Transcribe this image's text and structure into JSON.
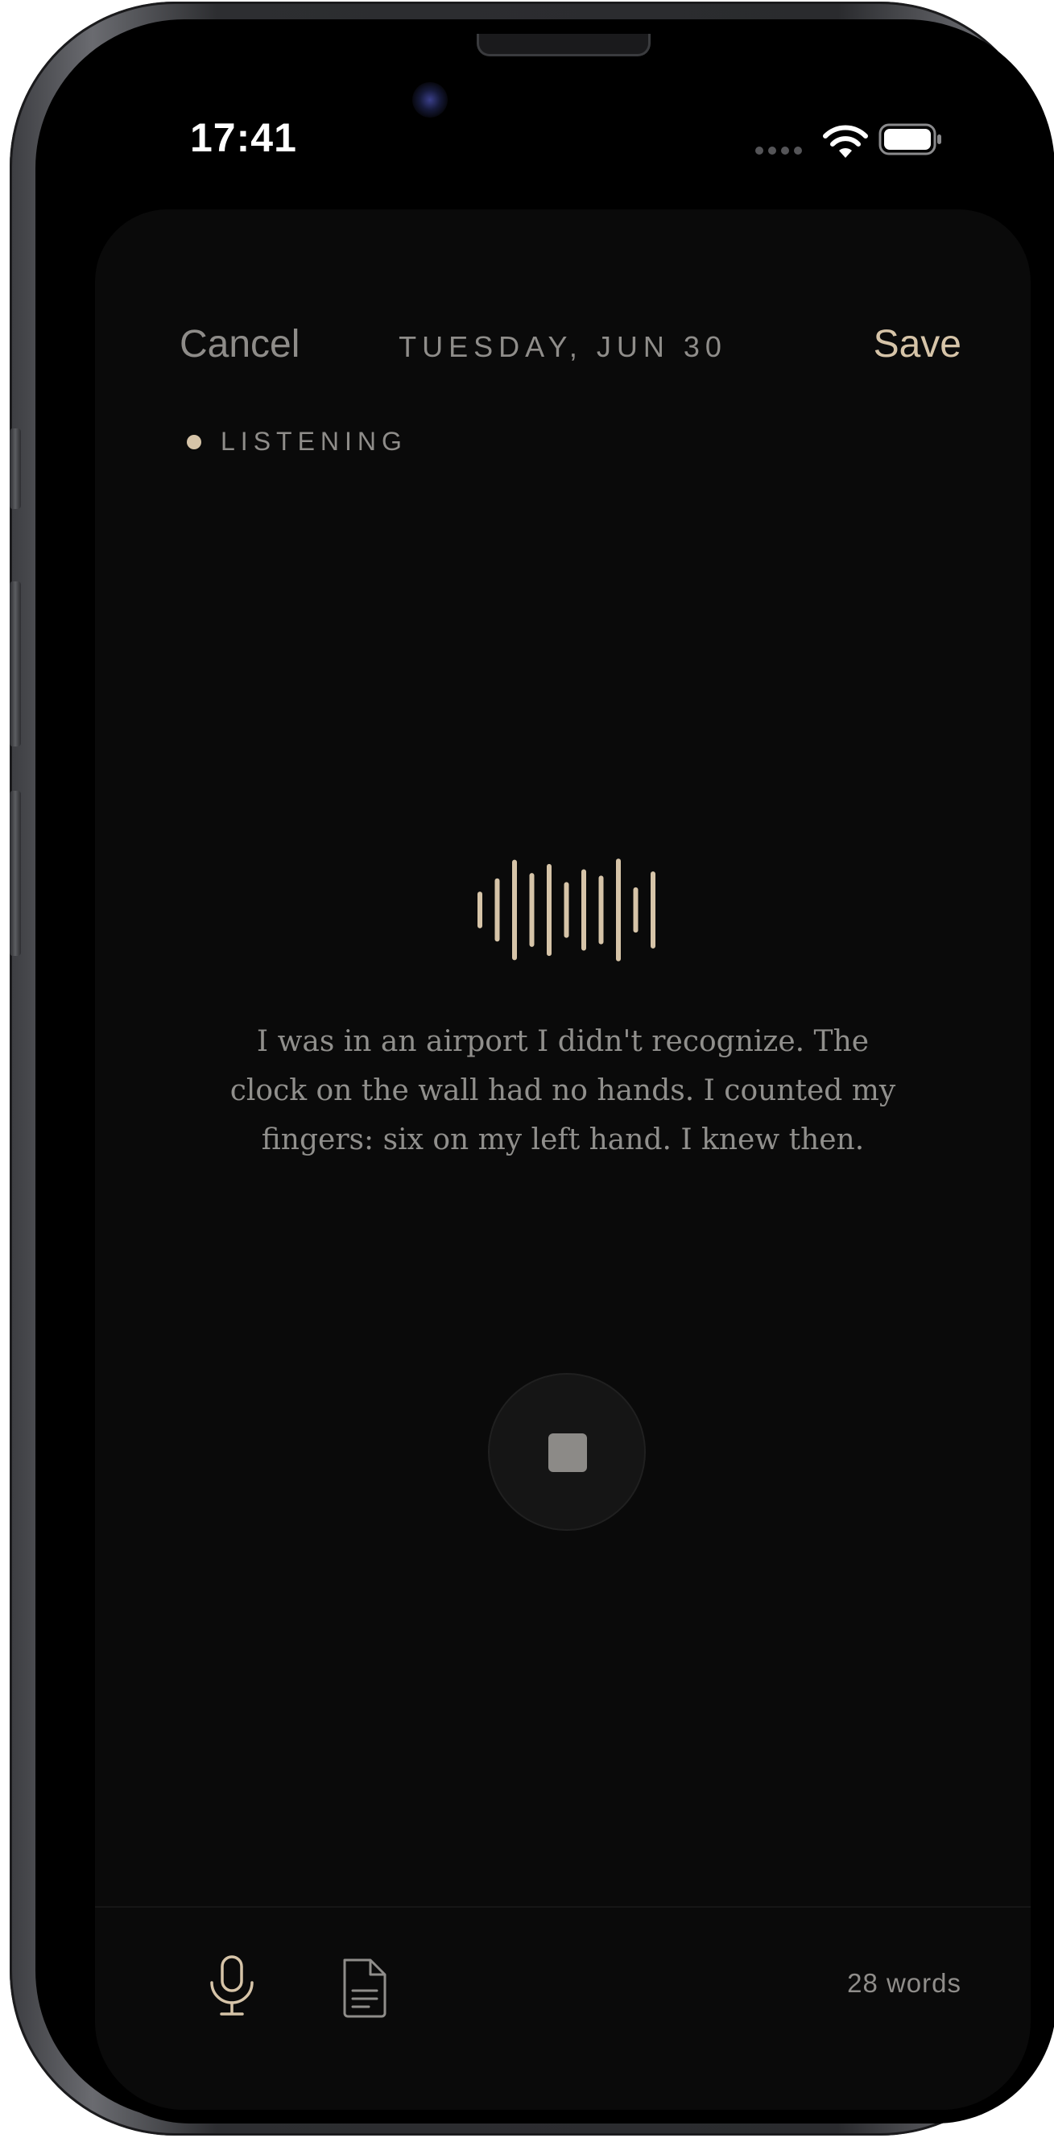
{
  "status_bar": {
    "time": "17:41",
    "icons": [
      "signal-dots-icon",
      "wifi-icon",
      "battery-icon"
    ]
  },
  "header": {
    "cancel_label": "Cancel",
    "date": "TUESDAY, JUN 30",
    "save_label": "Save"
  },
  "recording": {
    "status_label": "LISTENING",
    "transcript": "I was in an airport I didn't recognize. The clock on the wall had no hands. I counted my fingers: six on my left hand. I knew then.",
    "waveform_levels": [
      0.3,
      0.55,
      0.9,
      0.65,
      0.82,
      0.48,
      0.72,
      0.6,
      0.92,
      0.38,
      0.68
    ]
  },
  "toolbar": {
    "mic_icon": "microphone-icon",
    "doc_icon": "document-icon",
    "word_count": "28 words"
  },
  "colors": {
    "accent": "#d6c4a8",
    "background": "#0a0a0a",
    "muted_text": "#8f8d8a"
  }
}
